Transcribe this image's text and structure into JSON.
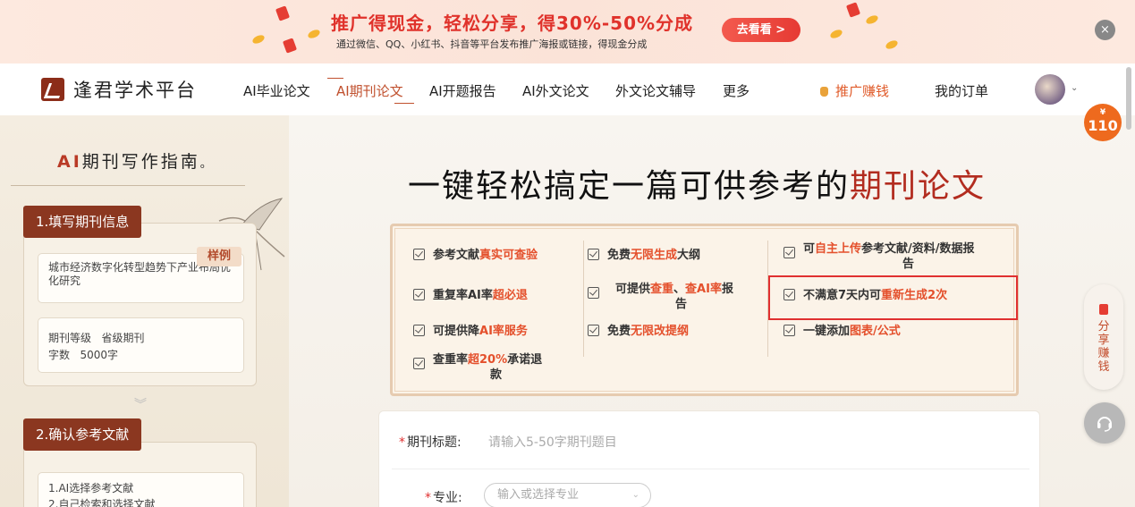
{
  "promo": {
    "title": "推广得现金，轻松分享，得30%-50%分成",
    "subtitle": "通过微信、QQ、小红书、抖音等平台发布推广海报或链接，得现金分成",
    "cta": "去看看 >",
    "close": "×"
  },
  "nav": {
    "brand": "逢君学术平台",
    "items": [
      "AI毕业论文",
      "AI期刊论文",
      "AI开题报告",
      "AI外文论文",
      "外文论文辅导",
      "更多"
    ],
    "promo_link": "推广赚钱",
    "orders": "我的订单",
    "avatar_caret": "⌄"
  },
  "sidebar": {
    "title_ai": "AI",
    "title_rest": "期刊写作指南",
    "title_dot": "。",
    "step1": {
      "label": "1.填写期刊信息",
      "sample_tag": "样例",
      "topic": "城市经济数字化转型趋势下产业布局优化研究",
      "level_label": "期刊等级",
      "level_value": "省级期刊",
      "words_label": "字数",
      "words_value": "5000字"
    },
    "chevron": "︾",
    "step2": {
      "label": "2.确认参考文献",
      "line1": "1.AI选择参考文献",
      "line2": "2.自己检索和选择文献"
    }
  },
  "main": {
    "hero_pre": "一键轻松搞定一篇可供参考的",
    "hero_hl": "期刊论文",
    "features": {
      "f1": [
        "参考文献",
        "真实可查验",
        ""
      ],
      "f2": [
        "免费",
        "无限生成",
        "大纲"
      ],
      "f3a": [
        "可",
        "自主上传",
        "参考文献/资料/数据报"
      ],
      "f3b": "告",
      "f4": [
        "重复率AI率",
        "超必退",
        ""
      ],
      "f5a": [
        "可提供",
        "查重",
        "、",
        "查AI率",
        "报"
      ],
      "f5b": "告",
      "f6": [
        "不满意7天内可",
        "重新生成2次",
        ""
      ],
      "f7": [
        "可提供降",
        "AI率服务",
        ""
      ],
      "f8": [
        "免费",
        "无限改提纲",
        ""
      ],
      "f9": [
        "一键添加",
        "图表/公式",
        ""
      ],
      "f10a": [
        "查重率",
        "超20%",
        "承诺退"
      ],
      "f10b": "款"
    },
    "form": {
      "title_label": "期刊标题:",
      "title_placeholder": "请输入5-50字期刊题目",
      "major_label": "专业:",
      "major_placeholder": "输入或选择专业",
      "required_mark": "*",
      "select_caret": "⌄"
    }
  },
  "floating": {
    "coupon_symbol": "¥",
    "coupon_value": "110",
    "share_text": "分享赚钱"
  },
  "colors": {
    "accent_red": "#e4502c",
    "brand_brown": "#8b3720",
    "highlight_frame": "#e03030"
  }
}
